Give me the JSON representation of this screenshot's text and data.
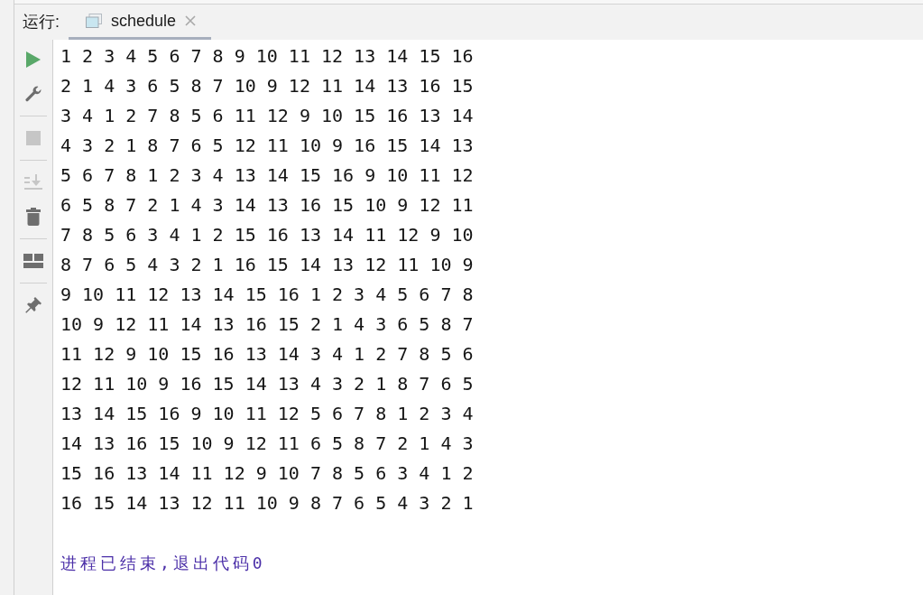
{
  "run_panel": {
    "label": "运行:",
    "tabs": [
      {
        "label": "schedule",
        "selected": true
      }
    ]
  },
  "toolbar": {
    "groups": [
      {
        "items": [
          {
            "kind": "run",
            "disabled": false
          },
          {
            "kind": "wrench",
            "disabled": false
          }
        ]
      },
      {
        "items": [
          {
            "kind": "stop",
            "disabled": true
          }
        ]
      },
      {
        "items": [
          {
            "kind": "scroll_end",
            "disabled": true
          },
          {
            "kind": "trash",
            "disabled": false
          }
        ]
      },
      {
        "items": [
          {
            "kind": "layout",
            "disabled": false
          }
        ]
      },
      {
        "items": [
          {
            "kind": "pin",
            "disabled": false
          }
        ]
      }
    ]
  },
  "console": {
    "lines": [
      "1 2 3 4 5 6 7 8 9 10 11 12 13 14 15 16",
      "2 1 4 3 6 5 8 7 10 9 12 11 14 13 16 15",
      "3 4 1 2 7 8 5 6 11 12 9 10 15 16 13 14",
      "4 3 2 1 8 7 6 5 12 11 10 9 16 15 14 13",
      "5 6 7 8 1 2 3 4 13 14 15 16 9 10 11 12",
      "6 5 8 7 2 1 4 3 14 13 16 15 10 9 12 11",
      "7 8 5 6 3 4 1 2 15 16 13 14 11 12 9 10",
      "8 7 6 5 4 3 2 1 16 15 14 13 12 11 10 9",
      "9 10 11 12 13 14 15 16 1 2 3 4 5 6 7 8",
      "10 9 12 11 14 13 16 15 2 1 4 3 6 5 8 7",
      "11 12 9 10 15 16 13 14 3 4 1 2 7 8 5 6",
      "12 11 10 9 16 15 14 13 4 3 2 1 8 7 6 5",
      "13 14 15 16 9 10 11 12 5 6 7 8 1 2 3 4",
      "14 13 16 15 10 9 12 11 6 5 8 7 2 1 4 3",
      "15 16 13 14 11 12 9 10 7 8 5 6 3 4 1 2",
      "16 15 14 13 12 11 10 9 8 7 6 5 4 3 2 1"
    ],
    "exit_message": "进程已结束,退出代码0"
  }
}
